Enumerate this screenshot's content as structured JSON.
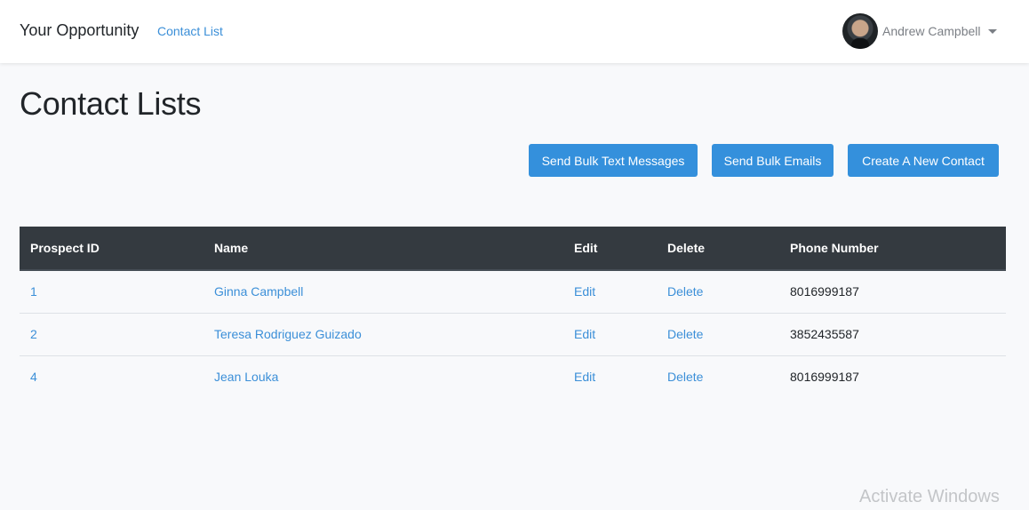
{
  "navbar": {
    "brand": "Your Opportunity",
    "links": [
      {
        "label": "Contact List"
      }
    ],
    "user": {
      "name": "Andrew Campbell",
      "avatar_icon": "user-avatar-photo"
    }
  },
  "page": {
    "title": "Contact Lists"
  },
  "actions": {
    "send_bulk_text": "Send Bulk Text Messages",
    "send_bulk_emails": "Send Bulk Emails",
    "create_contact": "Create A New Contact",
    "button_color": "#3490dc"
  },
  "table": {
    "headers": [
      "Prospect ID",
      "Name",
      "Edit",
      "Delete",
      "Phone Number"
    ],
    "header_bg": "#343a40",
    "rows": [
      {
        "id": "1",
        "name": "Ginna Campbell",
        "edit": "Edit",
        "delete": "Delete",
        "phone": "8016999187"
      },
      {
        "id": "2",
        "name": "Teresa Rodriguez Guizado",
        "edit": "Edit",
        "delete": "Delete",
        "phone": "3852435587"
      },
      {
        "id": "4",
        "name": "Jean Louka",
        "edit": "Edit",
        "delete": "Delete",
        "phone": "8016999187"
      }
    ]
  },
  "watermark": "Activate Windows"
}
